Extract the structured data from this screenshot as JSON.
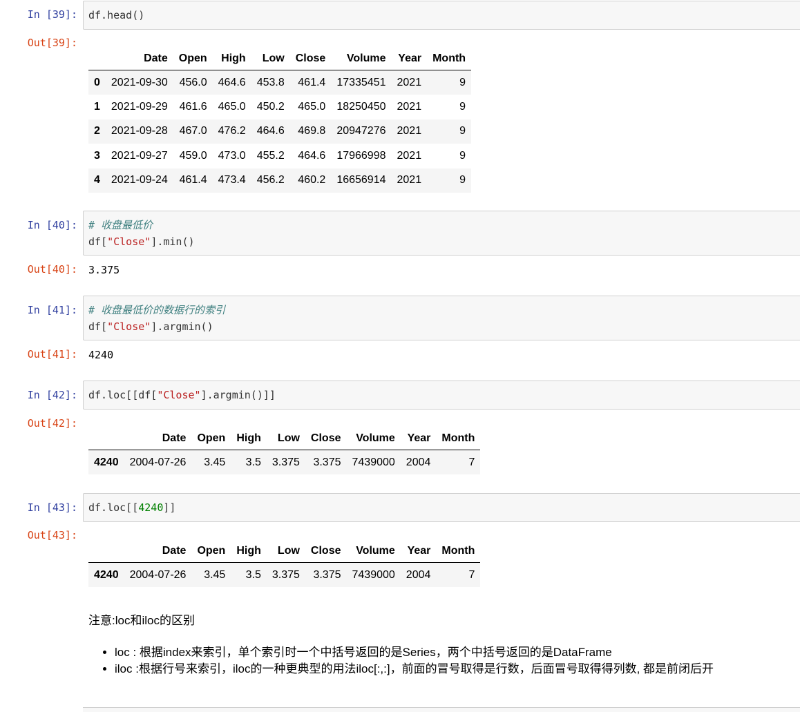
{
  "cells": [
    {
      "in_prompt": "In  [39]:",
      "out_prompt": "Out[39]:",
      "code": "df.head()"
    },
    {
      "in_prompt": "In  [40]:",
      "out_prompt": "Out[40]:",
      "comment": "# 收盘最低价",
      "code_pre": "df[",
      "code_str": "\"Close\"",
      "code_post": "].min()",
      "output": "3.375"
    },
    {
      "in_prompt": "In  [41]:",
      "out_prompt": "Out[41]:",
      "comment": "# 收盘最低价的数据行的索引",
      "code_pre": "df[",
      "code_str": "\"Close\"",
      "code_post": "].argmin()",
      "output": "4240"
    },
    {
      "in_prompt": "In  [42]:",
      "out_prompt": "Out[42]:",
      "code_pre": "df.loc[[df[",
      "code_str": "\"Close\"",
      "code_post": "].argmin()]]"
    },
    {
      "in_prompt": "In  [43]:",
      "out_prompt": "Out[43]:",
      "code_pre": "df.loc[[",
      "code_num": "4240",
      "code_post": "]]"
    }
  ],
  "head_table": {
    "columns": [
      "",
      "Date",
      "Open",
      "High",
      "Low",
      "Close",
      "Volume",
      "Year",
      "Month"
    ],
    "rows": [
      [
        "0",
        "2021-09-30",
        "456.0",
        "464.6",
        "453.8",
        "461.4",
        "17335451",
        "2021",
        "9"
      ],
      [
        "1",
        "2021-09-29",
        "461.6",
        "465.0",
        "450.2",
        "465.0",
        "18250450",
        "2021",
        "9"
      ],
      [
        "2",
        "2021-09-28",
        "467.0",
        "476.2",
        "464.6",
        "469.8",
        "20947276",
        "2021",
        "9"
      ],
      [
        "3",
        "2021-09-27",
        "459.0",
        "473.0",
        "455.2",
        "464.6",
        "17966998",
        "2021",
        "9"
      ],
      [
        "4",
        "2021-09-24",
        "461.4",
        "473.4",
        "456.2",
        "460.2",
        "16656914",
        "2021",
        "9"
      ]
    ]
  },
  "loc_table": {
    "columns": [
      "",
      "Date",
      "Open",
      "High",
      "Low",
      "Close",
      "Volume",
      "Year",
      "Month"
    ],
    "rows": [
      [
        "4240",
        "2004-07-26",
        "3.45",
        "3.5",
        "3.375",
        "3.375",
        "7439000",
        "2004",
        "7"
      ]
    ]
  },
  "markdown": {
    "heading": "注意:loc和iloc的区别",
    "bullets": [
      "loc : 根据index来索引，单个索引时一个中括号返回的是Series，两个中括号返回的是DataFrame",
      "iloc :根据行号来索引，iloc的一种更典型的用法iloc[:,:]，前面的冒号取得是行数，后面冒号取得得列数, 都是前闭后开"
    ]
  },
  "colors": {
    "in_prompt": "#303f9f",
    "out_prompt": "#d84315",
    "string": "#ba2121",
    "number": "#008000",
    "comment": "#408080",
    "cell_background": "#f7f7f7"
  }
}
